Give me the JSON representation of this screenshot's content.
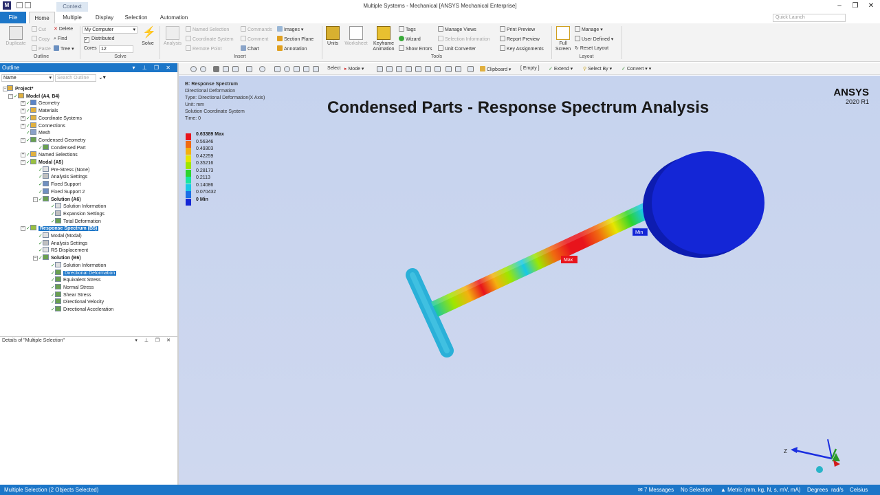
{
  "window": {
    "title": "Multiple Systems - Mechanical [ANSYS Mechanical Enterprise]",
    "context_tab": "Context",
    "controls": [
      "–",
      "❐",
      "✕"
    ]
  },
  "tabs": [
    "File",
    "Home",
    "Multiple",
    "Display",
    "Selection",
    "Automation"
  ],
  "quick_launch_placeholder": "Quick Launch",
  "ribbon": {
    "outline": {
      "label": "Outline",
      "duplicate": "Duplicate",
      "cut": "Cut",
      "copy": "Copy",
      "paste": "Paste",
      "delete": "Delete",
      "find": "Find",
      "tree": "Tree"
    },
    "solve": {
      "label": "Solve",
      "machine": "My Computer",
      "distributed": "Distributed",
      "cores_label": "Cores",
      "cores_value": "12",
      "solve_btn": "Solve"
    },
    "insert": {
      "label": "Insert",
      "analysis": "Analysis",
      "named_selection": "Named Selection",
      "coordinate_system": "Coordinate System",
      "remote_point": "Remote Point",
      "commands": "Commands",
      "comment": "Comment",
      "chart": "Chart",
      "images": "Images",
      "section_plane": "Section Plane",
      "annotation": "Annotation"
    },
    "tools": {
      "label": "Tools",
      "units": "Units",
      "worksheet": "Worksheet",
      "keyframe": "Keyframe Animation",
      "tags": "Tags",
      "wizard": "Wizard",
      "show_errors": "Show Errors",
      "manage_views": "Manage Views",
      "selection_information": "Selection Information",
      "unit_converter": "Unit Converter",
      "print_preview": "Print Preview",
      "report_preview": "Report Preview",
      "key_assignments": "Key Assignments"
    },
    "layout": {
      "label": "Layout",
      "full_screen": "Full Screen",
      "manage": "Manage",
      "user_defined": "User Defined",
      "reset_layout": "Reset Layout"
    }
  },
  "outline_panel": {
    "title": "Outline",
    "name_filter": "Name",
    "search_placeholder": "Search Outline",
    "tree": [
      {
        "label": "Project*",
        "bold": true
      },
      {
        "label": "Model (A4, B4)",
        "bold": true
      },
      {
        "label": "Geometry"
      },
      {
        "label": "Materials"
      },
      {
        "label": "Coordinate Systems"
      },
      {
        "label": "Connections"
      },
      {
        "label": "Mesh"
      },
      {
        "label": "Condensed Geometry"
      },
      {
        "label": "Condensed Part"
      },
      {
        "label": "Named Selections"
      },
      {
        "label": "Modal (A5)",
        "bold": true
      },
      {
        "label": "Pre-Stress (None)"
      },
      {
        "label": "Analysis Settings"
      },
      {
        "label": "Fixed Support"
      },
      {
        "label": "Fixed Support 2"
      },
      {
        "label": "Solution (A6)",
        "bold": true
      },
      {
        "label": "Solution Information"
      },
      {
        "label": "Expansion Settings"
      },
      {
        "label": "Total Deformation"
      },
      {
        "label": "Response Spectrum (B5)",
        "bold": true,
        "selected": true
      },
      {
        "label": "Modal (Modal)"
      },
      {
        "label": "Analysis Settings"
      },
      {
        "label": "RS Displacement"
      },
      {
        "label": "Solution (B6)",
        "bold": true
      },
      {
        "label": "Solution Information"
      },
      {
        "label": "Directional Deformation",
        "selected": true
      },
      {
        "label": "Equivalent Stress"
      },
      {
        "label": "Normal Stress"
      },
      {
        "label": "Shear Stress"
      },
      {
        "label": "Directional Velocity"
      },
      {
        "label": "Directional Acceleration"
      }
    ]
  },
  "details_panel": {
    "title": "Details of \"Multiple Selection\""
  },
  "graphics_toolbar": {
    "select": "Select",
    "mode": "Mode",
    "clipboard": "Clipboard",
    "empty": "[ Empty ]",
    "extend": "Extend",
    "select_by": "Select By",
    "convert": "Convert"
  },
  "viewport": {
    "info": [
      "B: Response Spectrum",
      "Directional Deformation",
      "Type: Directional Deformation(X Axis)",
      "Unit: mm",
      "Solution Coordinate System",
      "Time: 0"
    ],
    "title": "Condensed Parts - Response Spectrum Analysis",
    "brand": "ANSYS",
    "brand_version": "2020 R1",
    "legend": [
      {
        "value": "0.63389 Max",
        "color": "#e8141c"
      },
      {
        "value": "0.56346",
        "color": "#f06a10"
      },
      {
        "value": "0.49303",
        "color": "#f4b010"
      },
      {
        "value": "0.42259",
        "color": "#e6e600"
      },
      {
        "value": "0.35216",
        "color": "#9ee600"
      },
      {
        "value": "0.28173",
        "color": "#2ed42e"
      },
      {
        "value": "0.2113",
        "color": "#18e6a0"
      },
      {
        "value": "0.14086",
        "color": "#18c8e6"
      },
      {
        "value": "0.070432",
        "color": "#1a6ee6"
      },
      {
        "value": "0 Min",
        "color": "#1426d6"
      }
    ],
    "max_label": "Max",
    "min_label": "Min",
    "triad_z": "Z"
  },
  "status_bar": {
    "selection": "Multiple Selection (2 Objects Selected)",
    "messages": "7 Messages",
    "no_selection": "No Selection",
    "units": "Metric (mm, kg, N, s, mV, mA)",
    "angle": "Degrees",
    "rate": "rad/s",
    "temp": "Celsius"
  }
}
